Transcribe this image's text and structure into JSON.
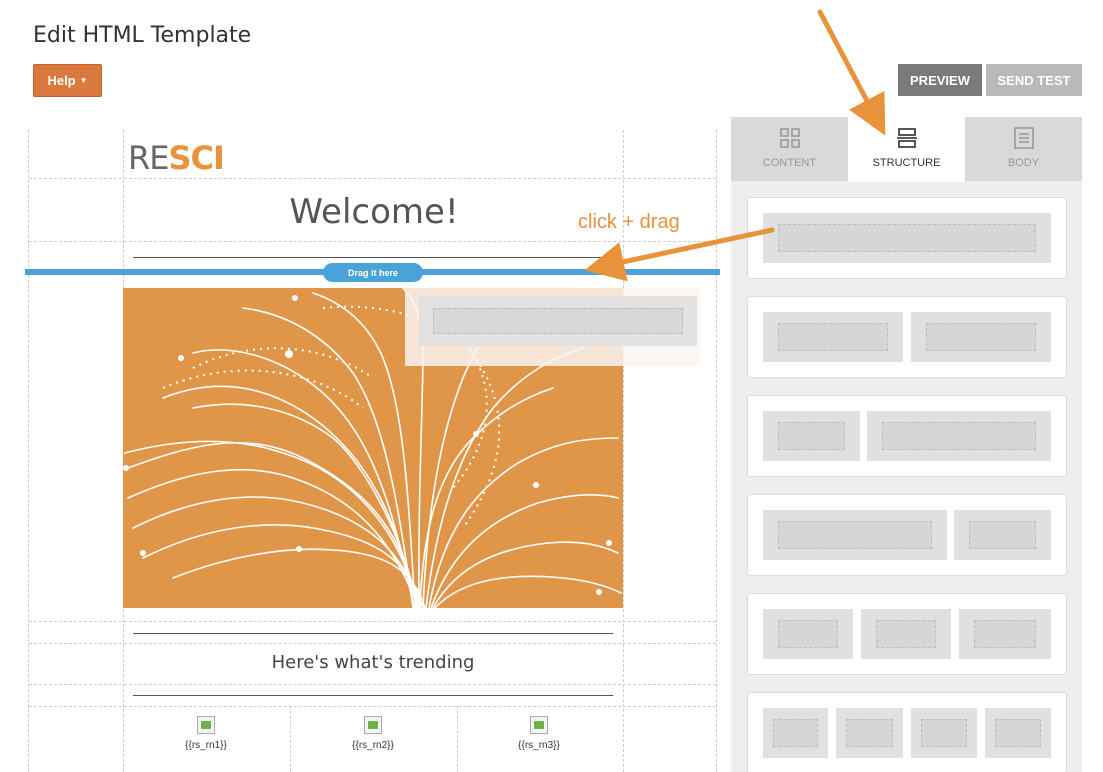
{
  "header": {
    "title": "Edit HTML Template",
    "help_label": "Help",
    "preview_label": "PREVIEW",
    "send_test_label": "SEND TEST"
  },
  "canvas": {
    "logo_re": "RE",
    "logo_sci": "SCI",
    "welcome": "Welcome!",
    "drag_hint": "Drag it here",
    "trending": "Here's what's trending",
    "products": [
      "{{rs_rn1}}",
      "{{rs_rn2}}",
      "{{rs_rn3}}"
    ]
  },
  "annotation": {
    "text": "click + drag",
    "color": "#e8923a"
  },
  "panel": {
    "tabs": [
      {
        "label": "CONTENT",
        "icon": "grid-icon",
        "active": false
      },
      {
        "label": "STRUCTURE",
        "icon": "rows-icon",
        "active": true
      },
      {
        "label": "BODY",
        "icon": "document-icon",
        "active": false
      }
    ],
    "structure_blocks": [
      {
        "columns": 1
      },
      {
        "columns": 2
      },
      {
        "columns": 2
      },
      {
        "columns": 2
      },
      {
        "columns": 3
      },
      {
        "columns": 4
      }
    ]
  },
  "colors": {
    "accent_orange": "#d9793d",
    "drop_blue": "#4aa3d8",
    "hero_orange": "#e09649"
  }
}
